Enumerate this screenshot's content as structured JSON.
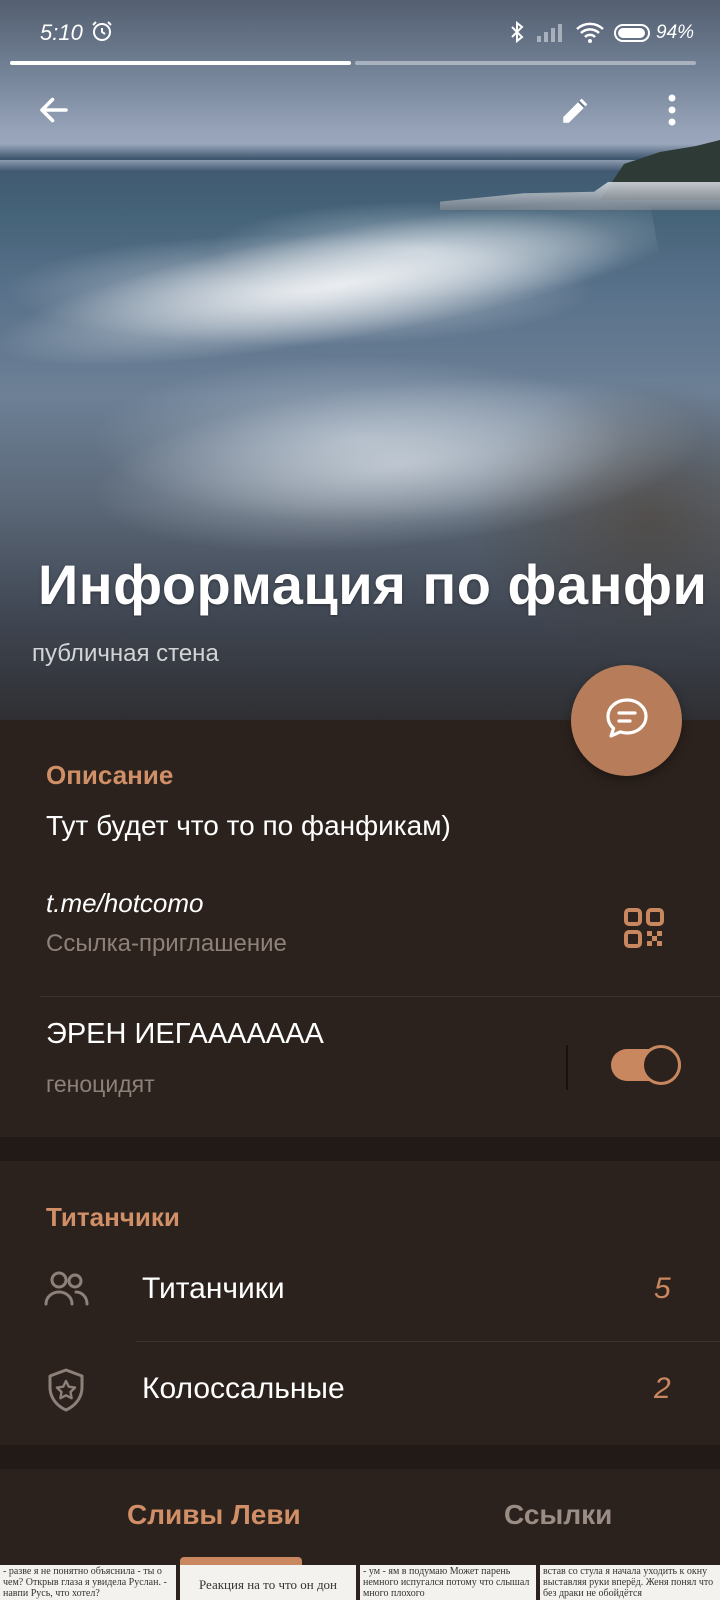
{
  "status_bar": {
    "time": "5:10",
    "battery": "94%"
  },
  "toolbar": {
    "back_icon": "arrow-left-icon",
    "edit_icon": "pencil-icon",
    "menu_icon": "more-vert-icon"
  },
  "header": {
    "title": "Информация по фанфи",
    "subtitle": "публичная стена"
  },
  "fab": {
    "icon": "chat-bubble-icon"
  },
  "info": {
    "description_header": "Описание",
    "description": "Тут будет что то по фанфикам)",
    "link": "t.me/hotcomo",
    "link_label": "Ссылка-приглашение",
    "qr_icon": "qr-code-icon",
    "setting_title": "ЭРЕН ИЕГААААААА",
    "setting_subtitle": "геноцидят",
    "setting_enabled": true
  },
  "members": {
    "header": "Титанчики",
    "items": [
      {
        "icon": "people-icon",
        "label": "Титанчики",
        "count": "5"
      },
      {
        "icon": "shield-star-icon",
        "label": "Колоссальные",
        "count": "2"
      }
    ]
  },
  "tabs": [
    {
      "label": "Сливы Леви",
      "active": true
    },
    {
      "label": "Ссылки",
      "active": false
    }
  ],
  "media_thumbs": [
    "- разве я не понятно объяснила - ты о чем? Открыв глаза я увидела Руслан. - навпи Русь, что хотел?",
    "Реакция на то что он дон",
    "- ум - ям в подумаю Может парень немного испугался потому что слышал много плохого",
    "встав со стула я начала уходить к окну выставляя руки вперёд. Женя понял что без драки не обойдётся"
  ],
  "colors": {
    "accent": "#c8875f",
    "section_bg": "#2c221d",
    "gap_bg": "#221a16"
  }
}
